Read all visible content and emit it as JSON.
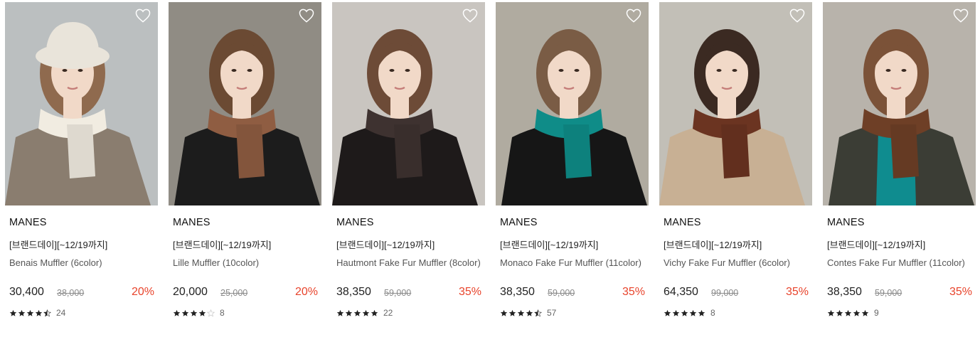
{
  "colors": {
    "discount": "#e8442c",
    "star": "#222222",
    "star_empty": "#c8c8c8"
  },
  "icons": {
    "wishlist": "heart-outline-icon",
    "star": "star-icon"
  },
  "products": [
    {
      "brand": "MANES",
      "promo": "[브랜드데이][~12/19까지]",
      "name": "Benais Muffler (6color)",
      "price": "30,400",
      "original_price": "38,000",
      "discount": "20%",
      "rating": 4.5,
      "review_count": "24",
      "photo": {
        "bg": "#c7cbcd",
        "coat": "#8a7d6f",
        "scarf": "#f1ece1",
        "hair": "#8f6a4e",
        "hat": "#e9e4da"
      }
    },
    {
      "brand": "MANES",
      "promo": "[브랜드데이][~12/19까지]",
      "name": "Lille Muffler (10color)",
      "price": "20,000",
      "original_price": "25,000",
      "discount": "20%",
      "rating": 4,
      "review_count": "8",
      "photo": {
        "bg": "#9a958d",
        "coat": "#1c1c1c",
        "scarf": "#8f5d42",
        "hair": "#6b4a33",
        "hat": ""
      }
    },
    {
      "brand": "MANES",
      "promo": "[브랜드데이][~12/19까지]",
      "name": "Hautmont Fake Fur Muffler (8color)",
      "price": "38,350",
      "original_price": "59,000",
      "discount": "35%",
      "rating": 5,
      "review_count": "22",
      "photo": {
        "bg": "#d6d2cc",
        "coat": "#1e1a1a",
        "scarf": "#3e3230",
        "hair": "#6d4b37",
        "hat": ""
      }
    },
    {
      "brand": "MANES",
      "promo": "[브랜드데이][~12/19까지]",
      "name": "Monaco Fake Fur Muffler (11color)",
      "price": "38,350",
      "original_price": "59,000",
      "discount": "35%",
      "rating": 4.5,
      "review_count": "57",
      "photo": {
        "bg": "#bcb6ab",
        "coat": "#161616",
        "scarf": "#0f8c88",
        "hair": "#7a5c45",
        "hat": ""
      }
    },
    {
      "brand": "MANES",
      "promo": "[브랜드데이][~12/19까지]",
      "name": "Vichy Fake Fur Muffler (6color)",
      "price": "64,350",
      "original_price": "99,000",
      "discount": "35%",
      "rating": 5,
      "review_count": "8",
      "photo": {
        "bg": "#cfcbc3",
        "coat": "#c8b094",
        "scarf": "#6b3421",
        "hair": "#3b2a22",
        "hat": ""
      }
    },
    {
      "brand": "MANES",
      "promo": "[브랜드데이][~12/19까지]",
      "name": "Contes Fake Fur Muffler (11color)",
      "price": "38,350",
      "original_price": "59,000",
      "discount": "35%",
      "rating": 5,
      "review_count": "9",
      "photo": {
        "bg": "#c4bfb6",
        "coat": "#3b3d35",
        "scarf": "#6e3f26",
        "hair": "#7b5238",
        "hat": "",
        "sweater": "#0f8c8f"
      }
    }
  ]
}
